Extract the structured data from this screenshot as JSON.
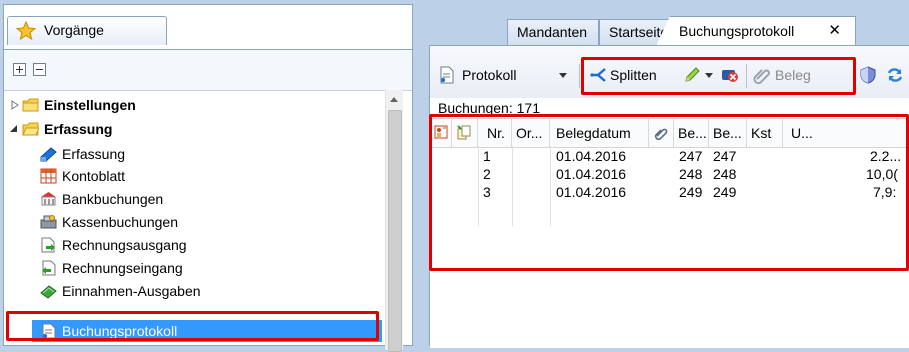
{
  "left_panel": {
    "tab_label": "Vorgänge",
    "tree": [
      {
        "label": "Einstellungen",
        "bold": true,
        "level": 0,
        "expanded": false
      },
      {
        "label": "Erfassung",
        "bold": true,
        "level": 0,
        "expanded": true
      },
      {
        "label": "Erfassung",
        "icon": "pen-icon",
        "level": 1
      },
      {
        "label": "Kontoblatt",
        "icon": "grid-icon",
        "level": 1
      },
      {
        "label": "Bankbuchungen",
        "icon": "bank-icon",
        "level": 1
      },
      {
        "label": "Kassenbuchungen",
        "icon": "cash-icon",
        "level": 1
      },
      {
        "label": "Rechnungsausgang",
        "icon": "invoice-out-icon",
        "level": 1
      },
      {
        "label": "Rechnungseingang",
        "icon": "invoice-in-icon",
        "level": 1
      },
      {
        "label": "Einnahmen-Ausgaben",
        "icon": "income-expense-icon",
        "level": 1
      },
      {
        "label": "Buchungsprotokoll",
        "icon": "protocol-icon",
        "level": 1,
        "selected": true
      }
    ]
  },
  "tabs": [
    {
      "label": "Mandanten",
      "active": false
    },
    {
      "label": "Startseite",
      "active": false
    },
    {
      "label": "Buchungsprotokoll",
      "active": true,
      "close": "✕"
    }
  ],
  "toolbar": {
    "protokoll_label": "Protokoll",
    "splitten_label": "Splitten",
    "beleg_label": "Beleg"
  },
  "count_label": "Buchungen: 171",
  "grid": {
    "columns": [
      "Nr.",
      "Or...",
      "Belegdatum",
      "Be...",
      "Be...",
      "Kst",
      "U..."
    ],
    "rows": [
      {
        "nr": "1",
        "belegdatum": "01.04.2016",
        "be1": "247",
        "be2": "247",
        "u": "2.2..."
      },
      {
        "nr": "2",
        "belegdatum": "01.04.2016",
        "be1": "248",
        "be2": "248",
        "u": "10,0("
      },
      {
        "nr": "3",
        "belegdatum": "01.04.2016",
        "be1": "249",
        "be2": "249",
        "u": "7,9:"
      }
    ]
  },
  "colors": {
    "highlight": "#e00000",
    "selection": "#3399ff",
    "chrome": "#bcd0e8"
  }
}
